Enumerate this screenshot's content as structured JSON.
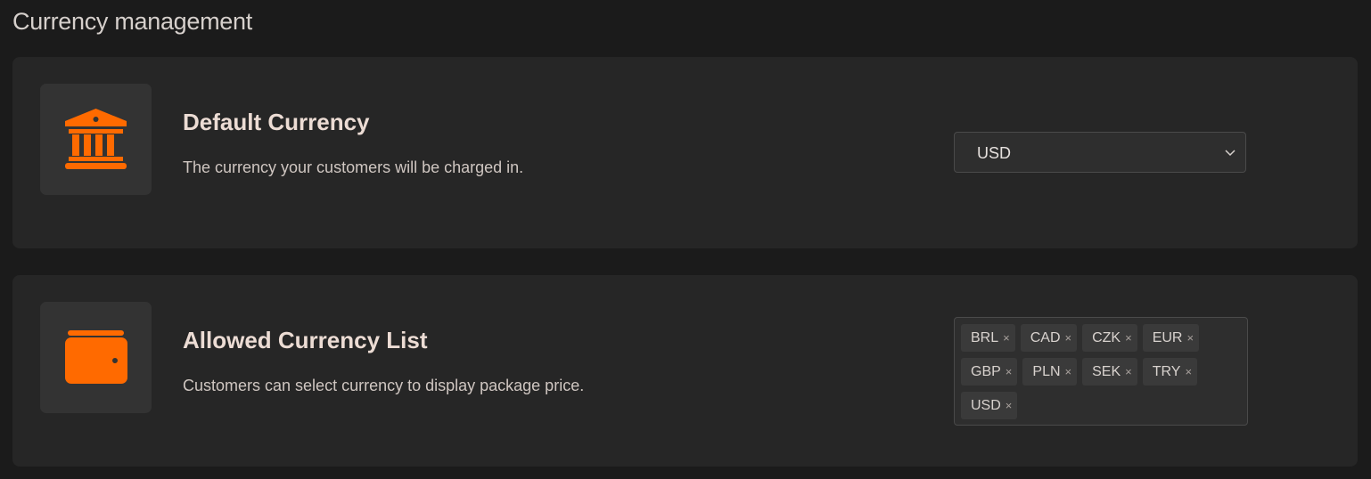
{
  "page": {
    "title": "Currency management"
  },
  "default_currency": {
    "title": "Default Currency",
    "description": "The currency your customers will be charged in.",
    "icon": "bank-icon",
    "selected": "USD"
  },
  "allowed_currencies": {
    "title": "Allowed Currency List",
    "description": "Customers can select currency to display package price.",
    "icon": "wallet-icon",
    "tags": [
      "BRL",
      "CAD",
      "CZK",
      "EUR",
      "GBP",
      "PLN",
      "SEK",
      "TRY",
      "USD"
    ],
    "remove_glyph": "×"
  },
  "colors": {
    "accent": "#ff6a00",
    "background": "#1b1b1b",
    "card": "#262626"
  }
}
